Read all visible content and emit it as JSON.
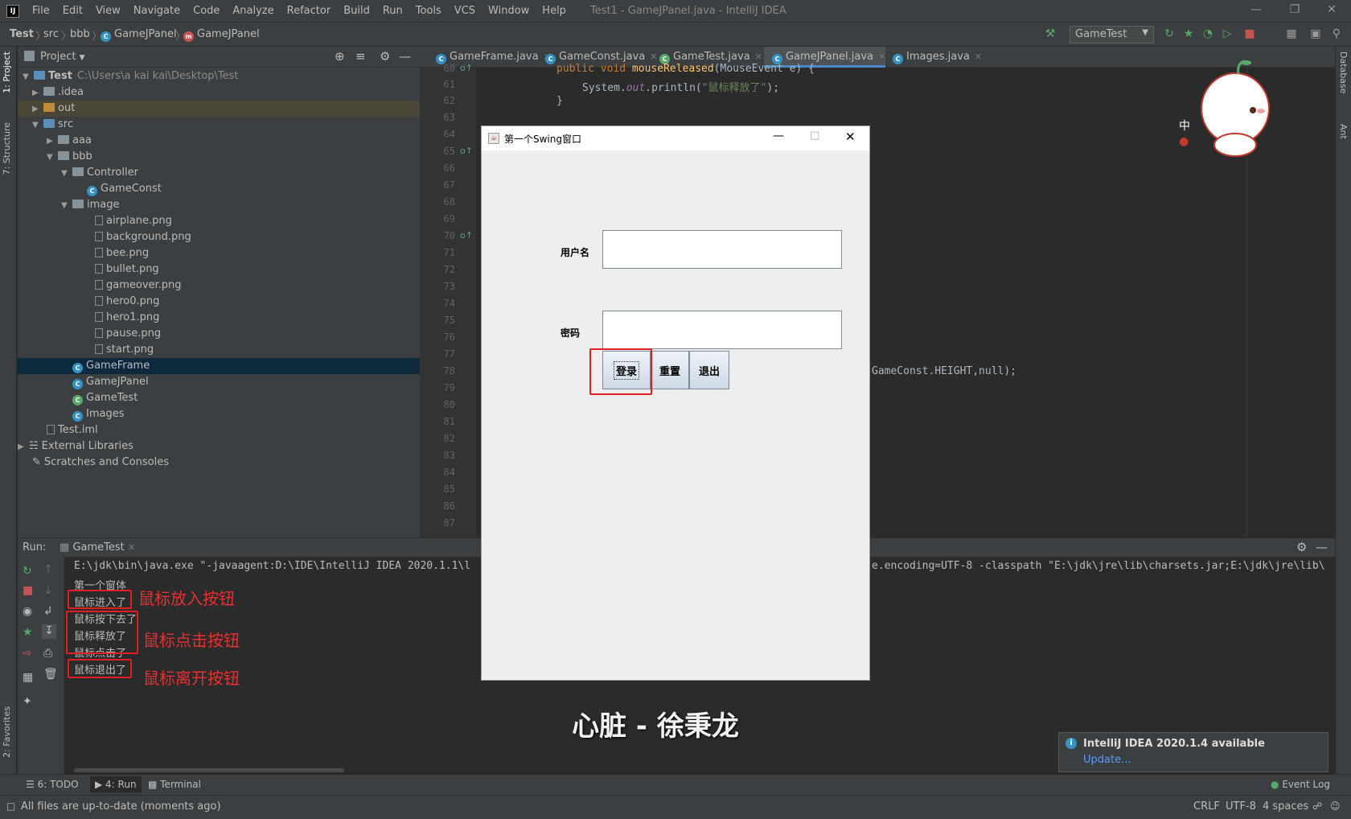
{
  "titlebar": {
    "menu": [
      "File",
      "Edit",
      "View",
      "Navigate",
      "Code",
      "Analyze",
      "Refactor",
      "Build",
      "Run",
      "Tools",
      "VCS",
      "Window",
      "Help"
    ],
    "window_title": "Test1 - GameJPanel.java - IntelliJ IDEA"
  },
  "navbar": {
    "crumbs": [
      "Test",
      "src",
      "bbb",
      "GameJPanel",
      "GameJPanel"
    ],
    "run_config": "GameTest"
  },
  "project": {
    "header": "Project",
    "root_name": "Test",
    "root_path": "C:\\Users\\a kai kai\\Desktop\\Test",
    "items": [
      ".idea",
      "out",
      "src",
      "aaa",
      "bbb",
      "Controller",
      "GameConst",
      "image",
      "airplane.png",
      "background.png",
      "bee.png",
      "bullet.png",
      "gameover.png",
      "hero0.png",
      "hero1.png",
      "pause.png",
      "start.png",
      "GameFrame",
      "GameJPanel",
      "GameTest",
      "Images",
      "Test.iml",
      "External Libraries",
      "Scratches and Consoles"
    ]
  },
  "left_stripe": {
    "project": "1: Project",
    "structure": "7: Structure",
    "favorites": "2: Favorites"
  },
  "right_stripe": {
    "database": "Database",
    "ant": "Ant"
  },
  "editor": {
    "tabs": [
      "GameFrame.java",
      "GameConst.java",
      "GameTest.java",
      "GameJPanel.java",
      "Images.java"
    ],
    "active_tab": "GameJPanel.java",
    "line_numbers": [
      "60",
      "61",
      "62",
      "63",
      "64",
      "65",
      "66",
      "67",
      "68",
      "69",
      "70",
      "71",
      "72",
      "73",
      "74",
      "75",
      "76",
      "77",
      "78",
      "79",
      "80",
      "81",
      "82",
      "83",
      "84",
      "85",
      "86",
      "87"
    ],
    "code": {
      "line60_kw": "public void ",
      "line60_fn": "mouseReleased",
      "line60_rest": "(MouseEvent e) {",
      "line61_a": "System.",
      "line61_out": "out",
      "line61_b": ".println(",
      "line61_str": "\"鼠标释放了\"",
      "line61_c": ");",
      "line62": "}",
      "line78_tail": "GameConst.HEIGHT,null);"
    }
  },
  "swing": {
    "title": "第一个Swing窗口",
    "username_label": "用户名",
    "password_label": "密码",
    "login": "登录",
    "reset": "重置",
    "exit": "退出"
  },
  "run": {
    "label": "Run:",
    "tab": "GameTest",
    "cmd_left": "E:\\jdk\\bin\\java.exe \"-javaagent:D:\\IDE\\IntelliJ IDEA 2020.1.1\\l",
    "cmd_right": "e.encoding=UTF-8 -classpath \"E:\\jdk\\jre\\lib\\charsets.jar;E:\\jdk\\jre\\lib\\",
    "lines": [
      "第一个窗体",
      "鼠标进入了",
      "鼠标按下去了",
      "鼠标释放了",
      "鼠标点击了",
      "鼠标退出了"
    ]
  },
  "annotations": {
    "enter": "鼠标放入按钮",
    "click": "鼠标点击按钮",
    "leave": "鼠标离开按钮"
  },
  "subtitle": "心脏 - 徐秉龙",
  "notification": {
    "title": "IntelliJ IDEA 2020.1.4 available",
    "link": "Update..."
  },
  "bottom_tabs": {
    "todo": "6: TODO",
    "run": "4: Run",
    "terminal": "Terminal",
    "event_log": "Event Log"
  },
  "status": {
    "message": "All files are up-to-date (moments ago)",
    "line_sep": "CRLF",
    "encoding": "UTF-8",
    "indent": "4 spaces"
  },
  "colors": {
    "accent": "#4a88c7",
    "annotation_red": "#e02020",
    "editor_bg": "#2b2b2b",
    "panel_bg": "#3c3f41"
  }
}
